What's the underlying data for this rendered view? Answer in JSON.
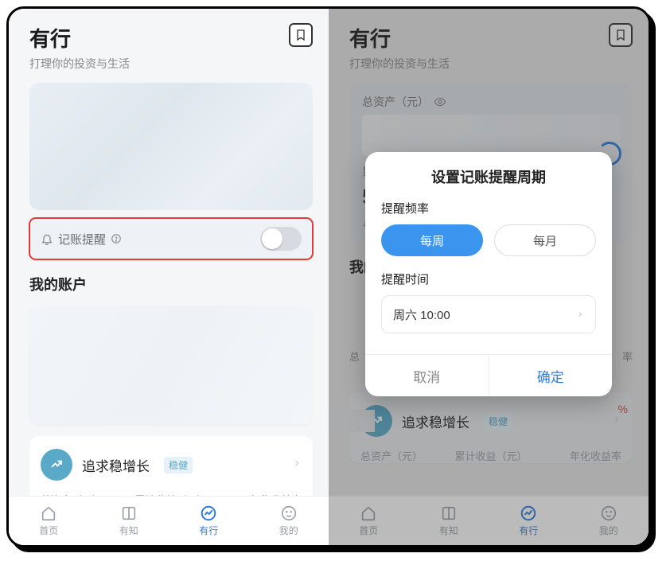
{
  "left": {
    "header": {
      "title": "有行",
      "subtitle": "打理你的投资与生活"
    },
    "reminder": {
      "label": "记账提醒"
    },
    "section_accounts": "我的账户",
    "account": {
      "title": "追求稳增长",
      "badge": "稳健",
      "stat1": "总资产（元）",
      "stat2": "累计收益（元）",
      "stat3": "年化收益率"
    },
    "tabs": {
      "home": "首页",
      "zhi": "有知",
      "xing": "有行",
      "mine": "我的"
    }
  },
  "right": {
    "header": {
      "title": "有行",
      "subtitle": "打理你的投资与生活"
    },
    "assets_label": "总资产（元）",
    "digit": "5",
    "cum_prefix": "累",
    "section_accounts": "我的账户",
    "account": {
      "title": "追求稳增长",
      "badge": "稳健",
      "stat1": "总资产（元）",
      "stat2": "累计收益（元）",
      "stat3": "年化收益率"
    },
    "stat1_short": "总",
    "stat3_short": "率",
    "red_pct": "%",
    "tabs": {
      "home": "首页",
      "zhi": "有知",
      "xing": "有行",
      "mine": "我的"
    },
    "modal": {
      "title": "设置记账提醒周期",
      "freq_label": "提醒频率",
      "weekly": "每周",
      "monthly": "每月",
      "time_label": "提醒时间",
      "time_value": "周六 10:00",
      "cancel": "取消",
      "ok": "确定"
    }
  }
}
